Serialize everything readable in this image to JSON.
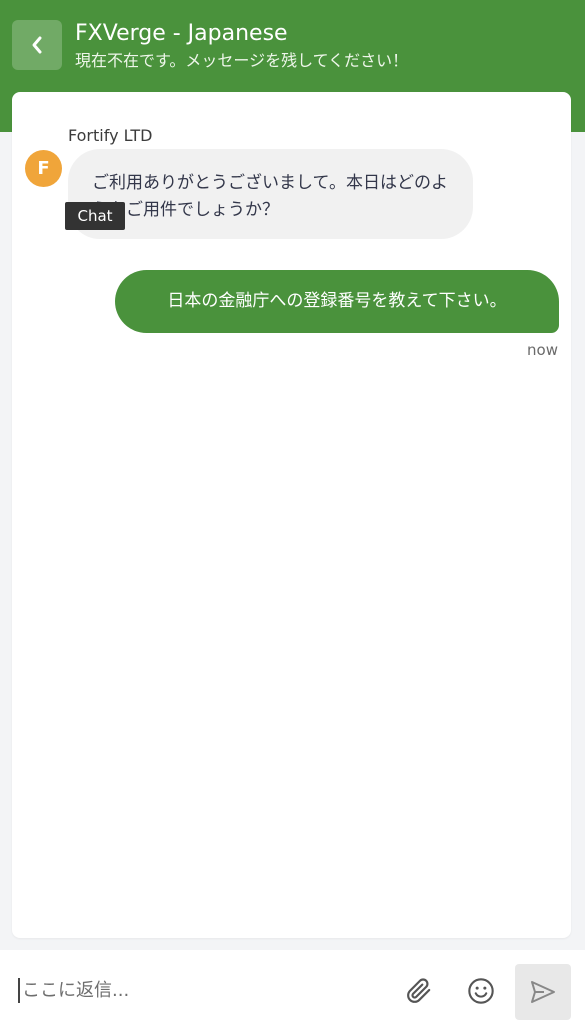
{
  "header": {
    "title": "FXVerge - Japanese",
    "subtitle": "現在不在です。メッセージを残してください！",
    "background_color": "#4a923c"
  },
  "conversation": {
    "incoming": {
      "sender": "Fortify LTD",
      "avatar_letter": "F",
      "avatar_color": "#f0a53a",
      "text": "ご利用ありがとうございまして。本日はどのようなご用件でしょうか？"
    },
    "tooltip": "Chat",
    "outgoing": {
      "text": "日本の金融庁への登録番号を教えて下さい。",
      "timestamp": "now",
      "bubble_color": "#4a923c"
    }
  },
  "composer": {
    "placeholder": "ここに返信...",
    "attach_icon": "paperclip-icon",
    "emoji_icon": "smiley-icon",
    "send_icon": "send-icon"
  }
}
